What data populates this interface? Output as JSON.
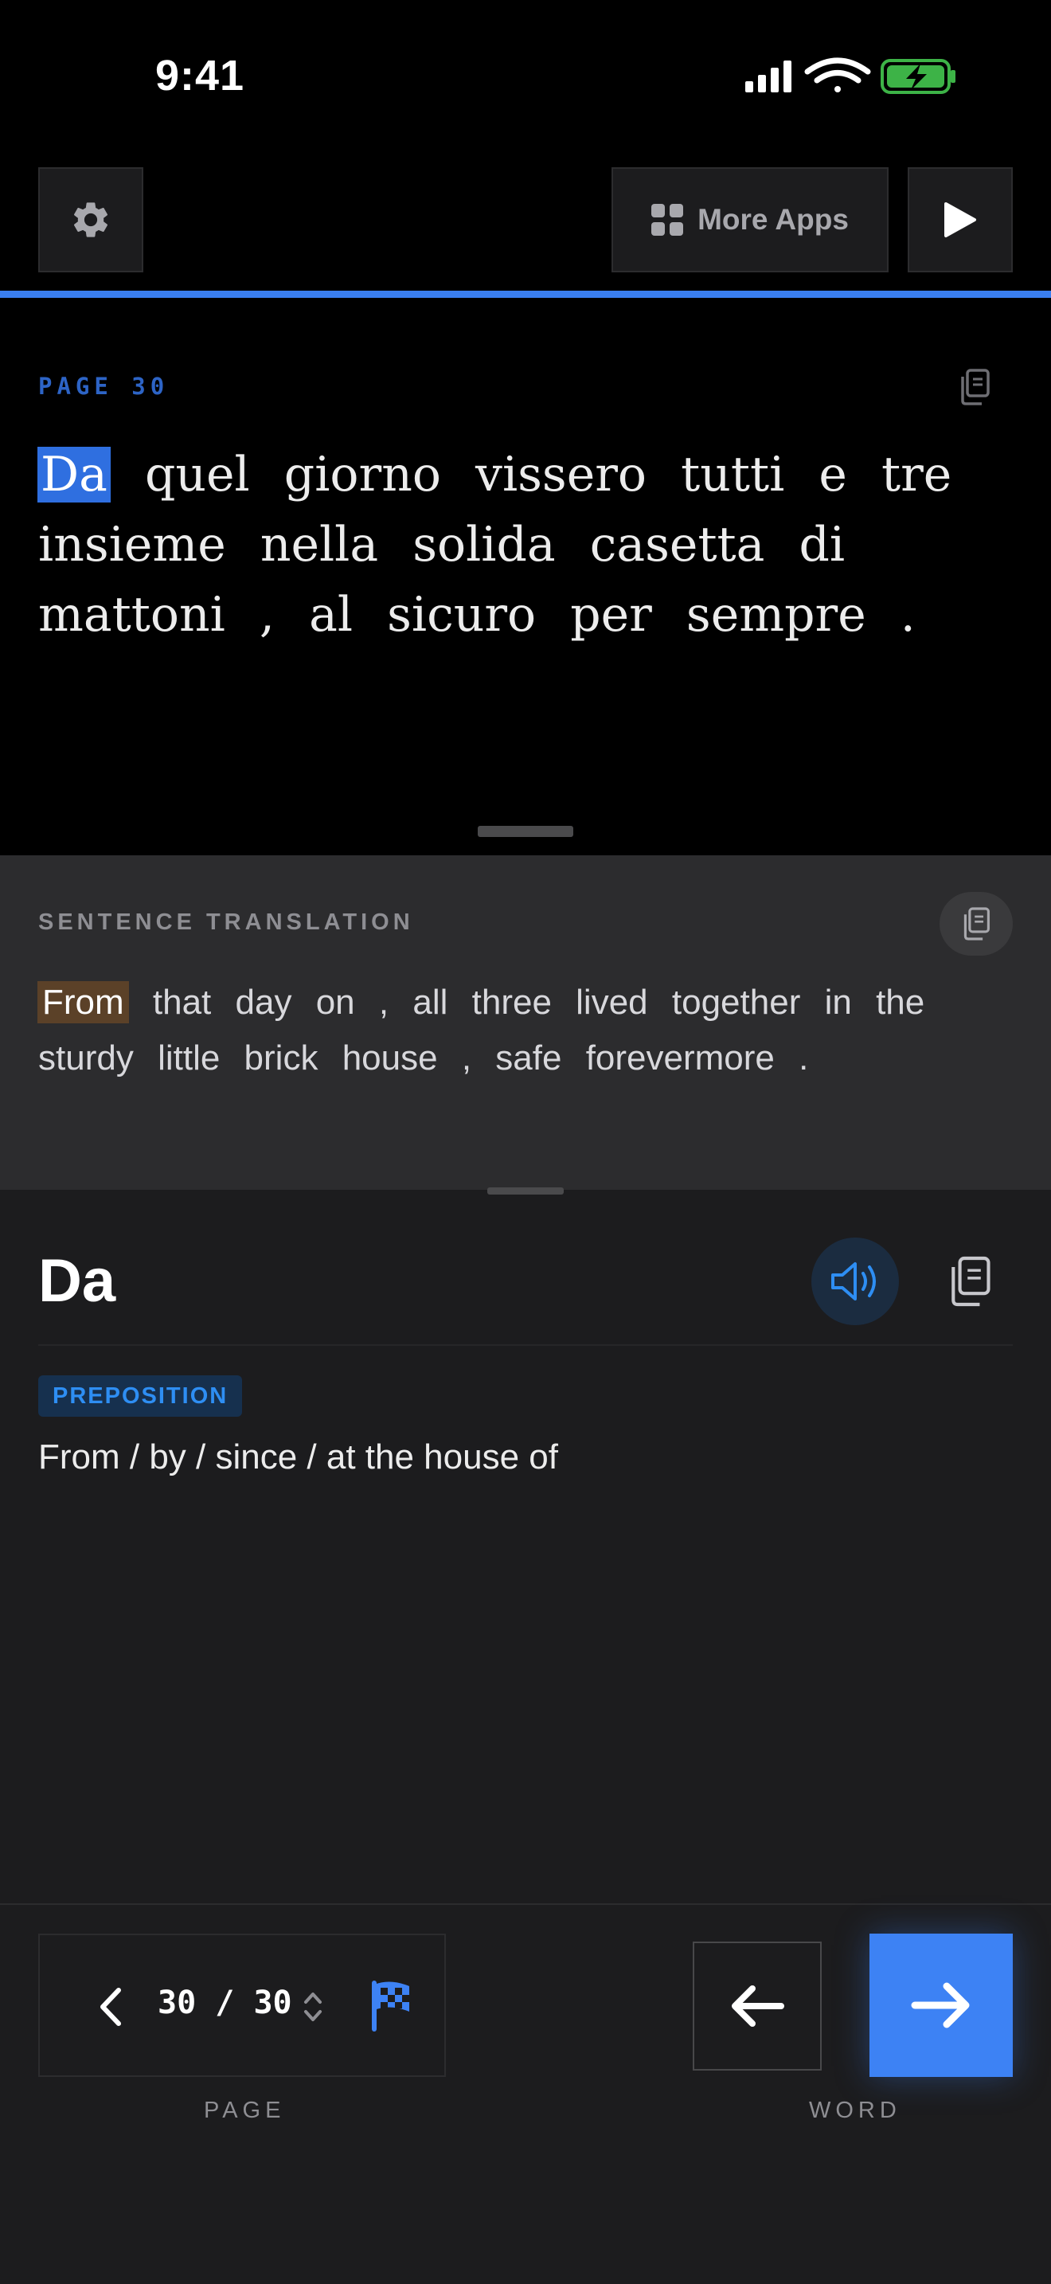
{
  "status_bar": {
    "time": "9:41",
    "icons": [
      "signal-icon",
      "wifi-icon",
      "battery-charging-icon"
    ]
  },
  "toolbar": {
    "more_apps_label": "More Apps",
    "icons": [
      "gear-icon",
      "grid-icon",
      "play-icon"
    ]
  },
  "reading": {
    "page_label": "PAGE 30",
    "progress": 1.0,
    "words": [
      "Da",
      "quel",
      "giorno",
      "vissero",
      "tutti",
      "e",
      "tre",
      "insieme",
      "nella",
      "solida",
      "casetta",
      "di",
      "mattoni",
      ",",
      "al",
      "sicuro",
      "per",
      "sempre",
      "."
    ],
    "highlighted_index": 0
  },
  "translation": {
    "label": "SENTENCE TRANSLATION",
    "words": [
      "From",
      "that",
      "day",
      "on",
      ",",
      "all",
      "three",
      "lived",
      "together",
      "in",
      "the",
      "sturdy",
      "little",
      "brick",
      "house",
      ",",
      "safe",
      "forevermore",
      "."
    ],
    "highlighted_index": 0
  },
  "word_detail": {
    "word": "Da",
    "part_of_speech": "PREPOSITION",
    "definition": "From / by / since / at the house of"
  },
  "navigation": {
    "page_current": "30",
    "page_total": "30",
    "page_separator": "/",
    "page_caption": "PAGE",
    "word_caption": "WORD"
  },
  "colors": {
    "accent": "#3d82f4",
    "word_highlight": "#2f6fe0",
    "translation_highlight": "#5b4128",
    "badge_text": "#2e8ef3"
  }
}
